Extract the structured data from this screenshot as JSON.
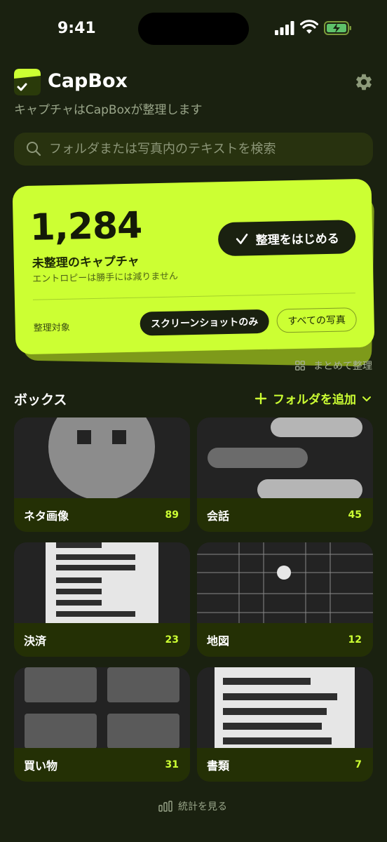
{
  "status_bar": {
    "time": "9:41"
  },
  "header": {
    "title": "CapBox",
    "subtitle": "キャプチャはCapBoxが整理します"
  },
  "search": {
    "placeholder": "フォルダまたは写真内のテキストを検索"
  },
  "hero": {
    "count": "1,284",
    "label": "未整理のキャプチャ",
    "subtitle": "エントロピーは勝手には減りません",
    "start_button": "整理をはじめる",
    "target_label": "整理対象",
    "chips": [
      "スクリーンショットのみ",
      "すべての写真"
    ]
  },
  "batch": {
    "label": "まとめて整理"
  },
  "boxes": {
    "title": "ボックス",
    "add_button": "フォルダを追加",
    "folders": [
      {
        "name": "ネタ画像",
        "count": "89"
      },
      {
        "name": "会話",
        "count": "45"
      },
      {
        "name": "決済",
        "count": "23"
      },
      {
        "name": "地図",
        "count": "12"
      },
      {
        "name": "買い物",
        "count": "31"
      },
      {
        "name": "書類",
        "count": "7"
      }
    ]
  },
  "footer": {
    "stats_link": "統計を見る"
  },
  "colors": {
    "accent": "#ccff33",
    "background": "#1a2110",
    "card_bar": "#243005"
  }
}
